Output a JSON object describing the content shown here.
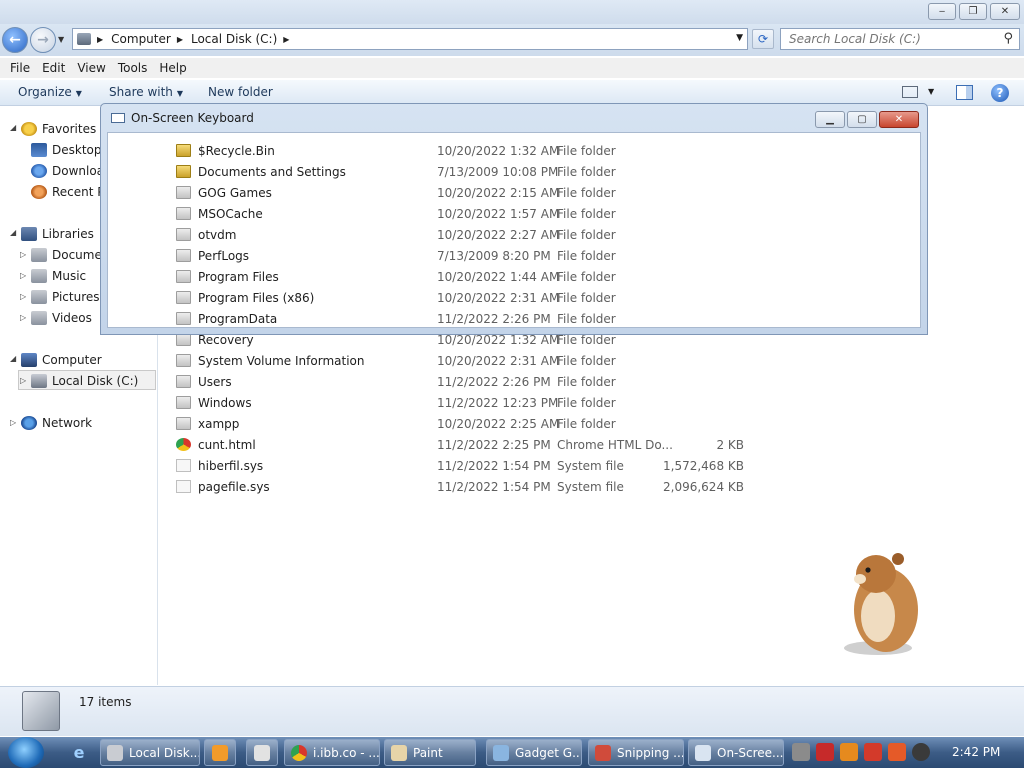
{
  "window": {
    "controls": {
      "minimize": "‒",
      "maximize": "❐",
      "close": "✕"
    }
  },
  "address": {
    "crumbs": [
      "Computer",
      "Local Disk (C:)"
    ],
    "search_placeholder": "Search Local Disk (C:)"
  },
  "menu": [
    "File",
    "Edit",
    "View",
    "Tools",
    "Help"
  ],
  "toolbar": {
    "organize": "Organize",
    "share_with": "Share with",
    "new_folder": "New folder"
  },
  "nav": {
    "favorites": "Favorites",
    "fav_items": [
      "Desktop",
      "Downloads",
      "Recent Places"
    ],
    "libraries": "Libraries",
    "lib_items": [
      "Documents",
      "Music",
      "Pictures",
      "Videos"
    ],
    "computer": "Computer",
    "local_disk": "Local Disk (C:)",
    "network": "Network"
  },
  "files": [
    {
      "name": "$Recycle.Bin",
      "date": "10/20/2022 1:32 AM",
      "type": "File folder",
      "size": "",
      "icon": "lock"
    },
    {
      "name": "Documents and Settings",
      "date": "7/13/2009 10:08 PM",
      "type": "File folder",
      "size": "",
      "icon": "lock"
    },
    {
      "name": "GOG Games",
      "date": "10/20/2022 2:15 AM",
      "type": "File folder",
      "size": "",
      "icon": "folder"
    },
    {
      "name": "MSOCache",
      "date": "10/20/2022 1:57 AM",
      "type": "File folder",
      "size": "",
      "icon": "folder"
    },
    {
      "name": "otvdm",
      "date": "10/20/2022 2:27 AM",
      "type": "File folder",
      "size": "",
      "icon": "folder"
    },
    {
      "name": "PerfLogs",
      "date": "7/13/2009 8:20 PM",
      "type": "File folder",
      "size": "",
      "icon": "folder"
    },
    {
      "name": "Program Files",
      "date": "10/20/2022 1:44 AM",
      "type": "File folder",
      "size": "",
      "icon": "folder"
    },
    {
      "name": "Program Files (x86)",
      "date": "10/20/2022 2:31 AM",
      "type": "File folder",
      "size": "",
      "icon": "folder"
    },
    {
      "name": "ProgramData",
      "date": "11/2/2022 2:26 PM",
      "type": "File folder",
      "size": "",
      "icon": "folder"
    },
    {
      "name": "Recovery",
      "date": "10/20/2022 1:32 AM",
      "type": "File folder",
      "size": "",
      "icon": "folder"
    },
    {
      "name": "System Volume Information",
      "date": "10/20/2022 2:31 AM",
      "type": "File folder",
      "size": "",
      "icon": "folder"
    },
    {
      "name": "Users",
      "date": "11/2/2022 2:26 PM",
      "type": "File folder",
      "size": "",
      "icon": "folder"
    },
    {
      "name": "Windows",
      "date": "11/2/2022 12:23 PM",
      "type": "File folder",
      "size": "",
      "icon": "folder"
    },
    {
      "name": "xampp",
      "date": "10/20/2022 2:25 AM",
      "type": "File folder",
      "size": "",
      "icon": "folder"
    },
    {
      "name": "cunt.html",
      "date": "11/2/2022 2:25 PM",
      "type": "Chrome HTML Do...",
      "size": "2 KB",
      "icon": "chrome"
    },
    {
      "name": "hiberfil.sys",
      "date": "11/2/2022 1:54 PM",
      "type": "System file",
      "size": "1,572,468 KB",
      "icon": "file"
    },
    {
      "name": "pagefile.sys",
      "date": "11/2/2022 1:54 PM",
      "type": "System file",
      "size": "2,096,624 KB",
      "icon": "file"
    }
  ],
  "osk": {
    "title": "On-Screen Keyboard"
  },
  "status": {
    "count": "17 items"
  },
  "taskbar": {
    "items": [
      "Local Disk...",
      "i.ibb.co - ...",
      "Paint",
      "Gadget G...",
      "Snipping ...",
      "On-Scree..."
    ],
    "clock": "2:42 PM"
  }
}
